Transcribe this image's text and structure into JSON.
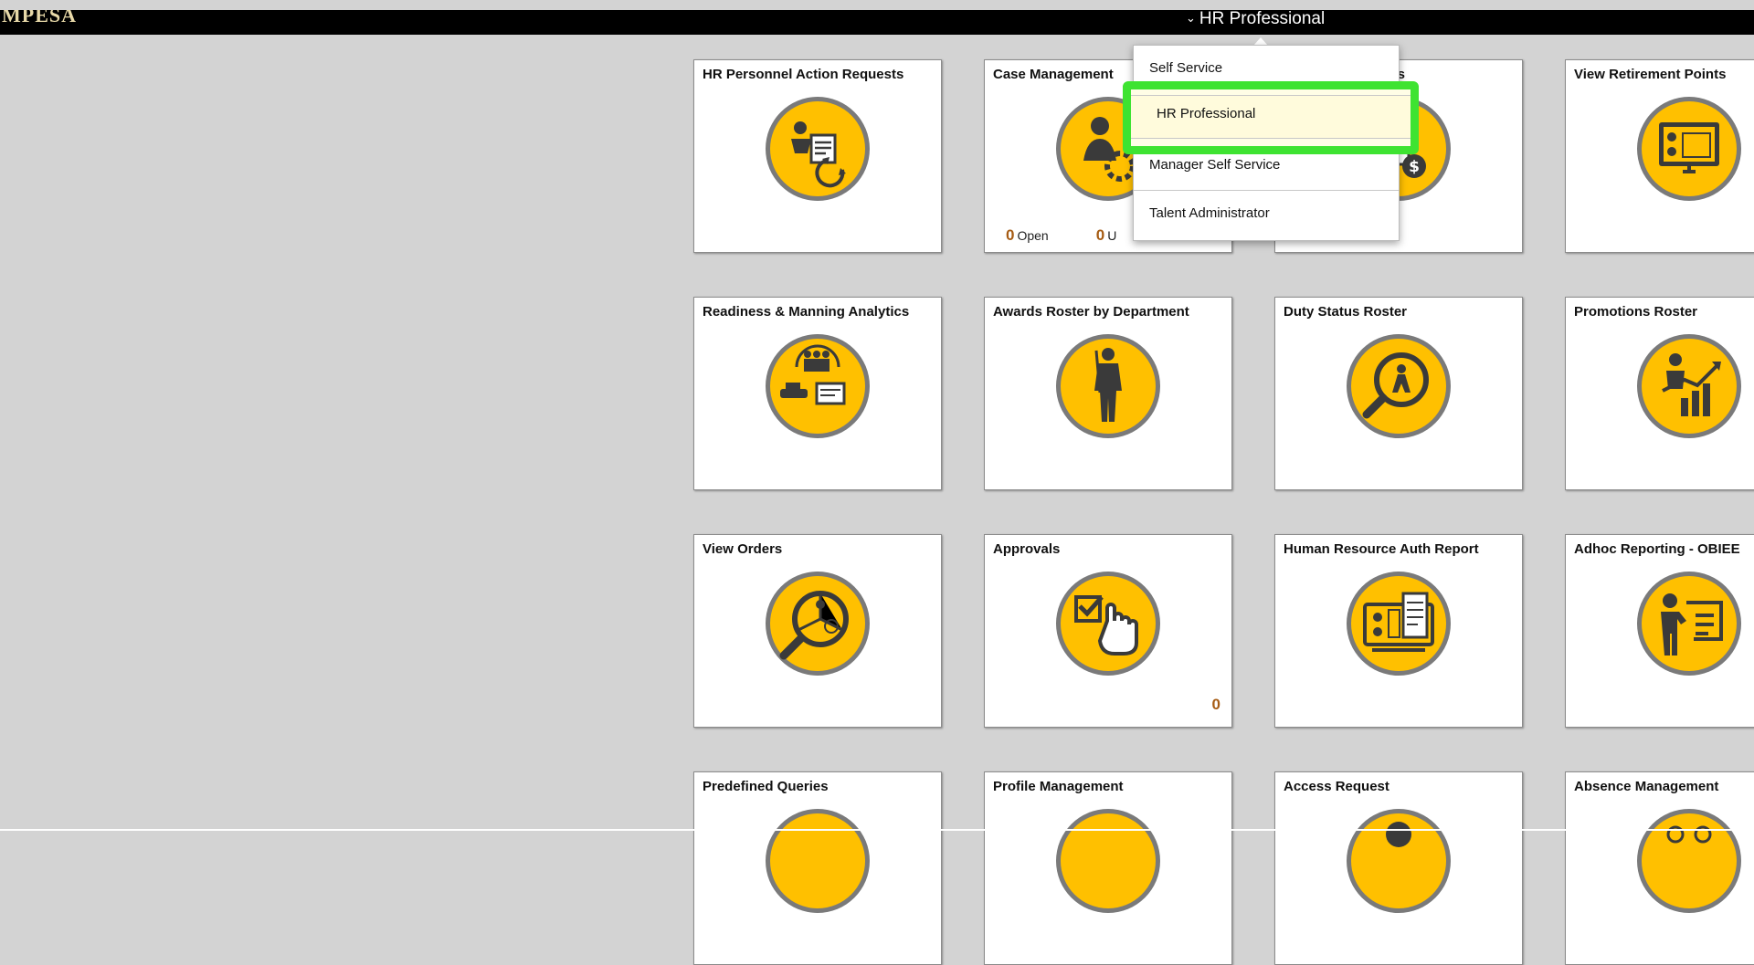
{
  "header": {
    "logo_text": "MPESA",
    "role_title": "HR Professional",
    "chevron": "⌄"
  },
  "dropdown": {
    "items": [
      {
        "label": "Self Service"
      },
      {
        "label": "HR Professional"
      },
      {
        "label": "Manager Self Service"
      },
      {
        "label": "Talent Administrator"
      }
    ],
    "selected": "HR Professional",
    "highlight_color": "#3ee331"
  },
  "tiles": [
    {
      "title": "HR Personnel Action Requests",
      "icon": "personnel-action-icon"
    },
    {
      "title": "Case Management",
      "icon": "case-management-icon",
      "stats": {
        "open_count": "0",
        "open_label": "Open",
        "second_count": "0",
        "second_label": "U"
      }
    },
    {
      "title": "ests",
      "icon": "payment-requests-icon"
    },
    {
      "title": "View Retirement Points",
      "icon": "retirement-points-icon"
    },
    {
      "title": "Readiness & Manning Analytics",
      "icon": "readiness-analytics-icon"
    },
    {
      "title": "Awards Roster by Department",
      "icon": "soldier-icon"
    },
    {
      "title": "Duty Status Roster",
      "icon": "duty-status-search-icon"
    },
    {
      "title": "Promotions Roster",
      "icon": "promotion-chart-icon"
    },
    {
      "title": "View Orders",
      "icon": "view-orders-icon"
    },
    {
      "title": "Approvals",
      "icon": "approvals-icon",
      "count": "0"
    },
    {
      "title": "Human Resource Auth Report",
      "icon": "auth-report-icon"
    },
    {
      "title": "Adhoc Reporting - OBIEE",
      "icon": "presenter-icon"
    },
    {
      "title": "Predefined Queries",
      "icon": "queries-icon"
    },
    {
      "title": "Profile Management",
      "icon": "profile-icon"
    },
    {
      "title": "Access Request",
      "icon": "access-request-icon"
    },
    {
      "title": "Absence Management",
      "icon": "absence-icon"
    }
  ],
  "colors": {
    "icon_fill": "#ffc000",
    "icon_ring": "#7a7a7a",
    "icon_glyph": "#3a3a3a",
    "count_color": "#a65c14",
    "header_bg": "#000000",
    "page_bg": "#d3d3d3"
  }
}
